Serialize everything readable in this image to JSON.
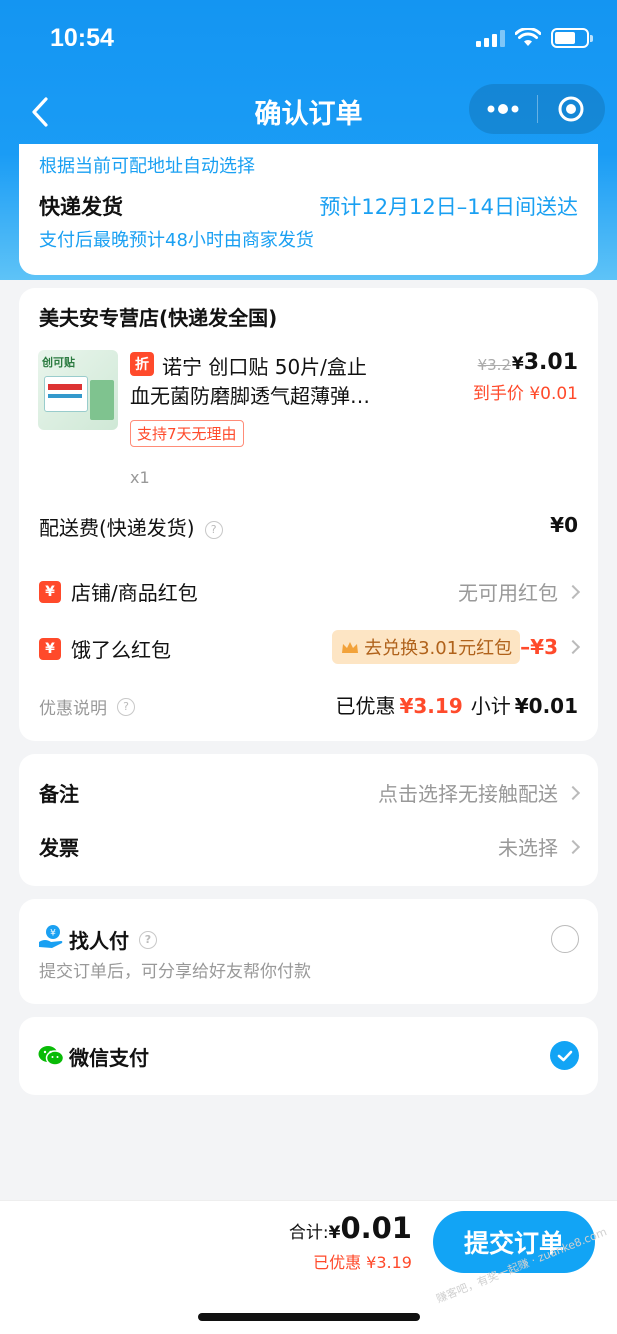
{
  "status": {
    "time": "10:54"
  },
  "nav": {
    "title": "确认订单",
    "back": "back",
    "more": "more",
    "close": "close"
  },
  "delivery": {
    "auto_select_note": "根据当前可配地址自动选择",
    "method": "快递发货",
    "eta": "预计12月12日–14日间送达",
    "ship_note": "支付后最晚预计48小时由商家发货"
  },
  "store": {
    "name": "美夫安专营店(快递发全国)",
    "product": {
      "discount_tag": "折",
      "title_line1": "诺宁 创口贴 50片/盒止",
      "title_line2": "血无菌防磨脚透气超薄弹…",
      "original_price": "¥3.2",
      "price_symbol": "¥",
      "price": "3.01",
      "final_price_label": "到手价",
      "final_price": "¥0.01",
      "return_badge": "支持7天无理由",
      "quantity": "x1",
      "thumb_label": "创可贴"
    },
    "shipping_fee_label": "配送费(快递发货)",
    "shipping_fee": "¥0",
    "shop_redpacket_label": "店铺/商品红包",
    "shop_redpacket_value": "无可用红包",
    "ele_redpacket_label": "饿了么红包",
    "ele_redpacket_exchange": "去兑换3.01元红包",
    "ele_redpacket_value": "–¥3",
    "discount_desc_label": "优惠说明",
    "saved_label": "已优惠",
    "saved_value": "¥3.19",
    "subtotal_label": "小计",
    "subtotal_value": "¥0.01"
  },
  "extras": {
    "remark_label": "备注",
    "remark_value": "点击选择无接触配送",
    "invoice_label": "发票",
    "invoice_value": "未选择"
  },
  "pay_by_friend": {
    "label": "找人付",
    "desc": "提交订单后，可分享给好友帮你付款"
  },
  "wechat_pay": {
    "label": "微信支付"
  },
  "bottom": {
    "total_label": "合计:",
    "total_symbol": "¥",
    "total_value": "0.01",
    "saved_text": "已优惠 ¥3.19",
    "submit_label": "提交订单",
    "watermark": "赚客吧，有奖一起赚 · zuanke8.com"
  },
  "colors": {
    "brand_blue": "#12a4f5",
    "accent_red": "#ff4a2b",
    "wechat_green": "#09bb07"
  }
}
